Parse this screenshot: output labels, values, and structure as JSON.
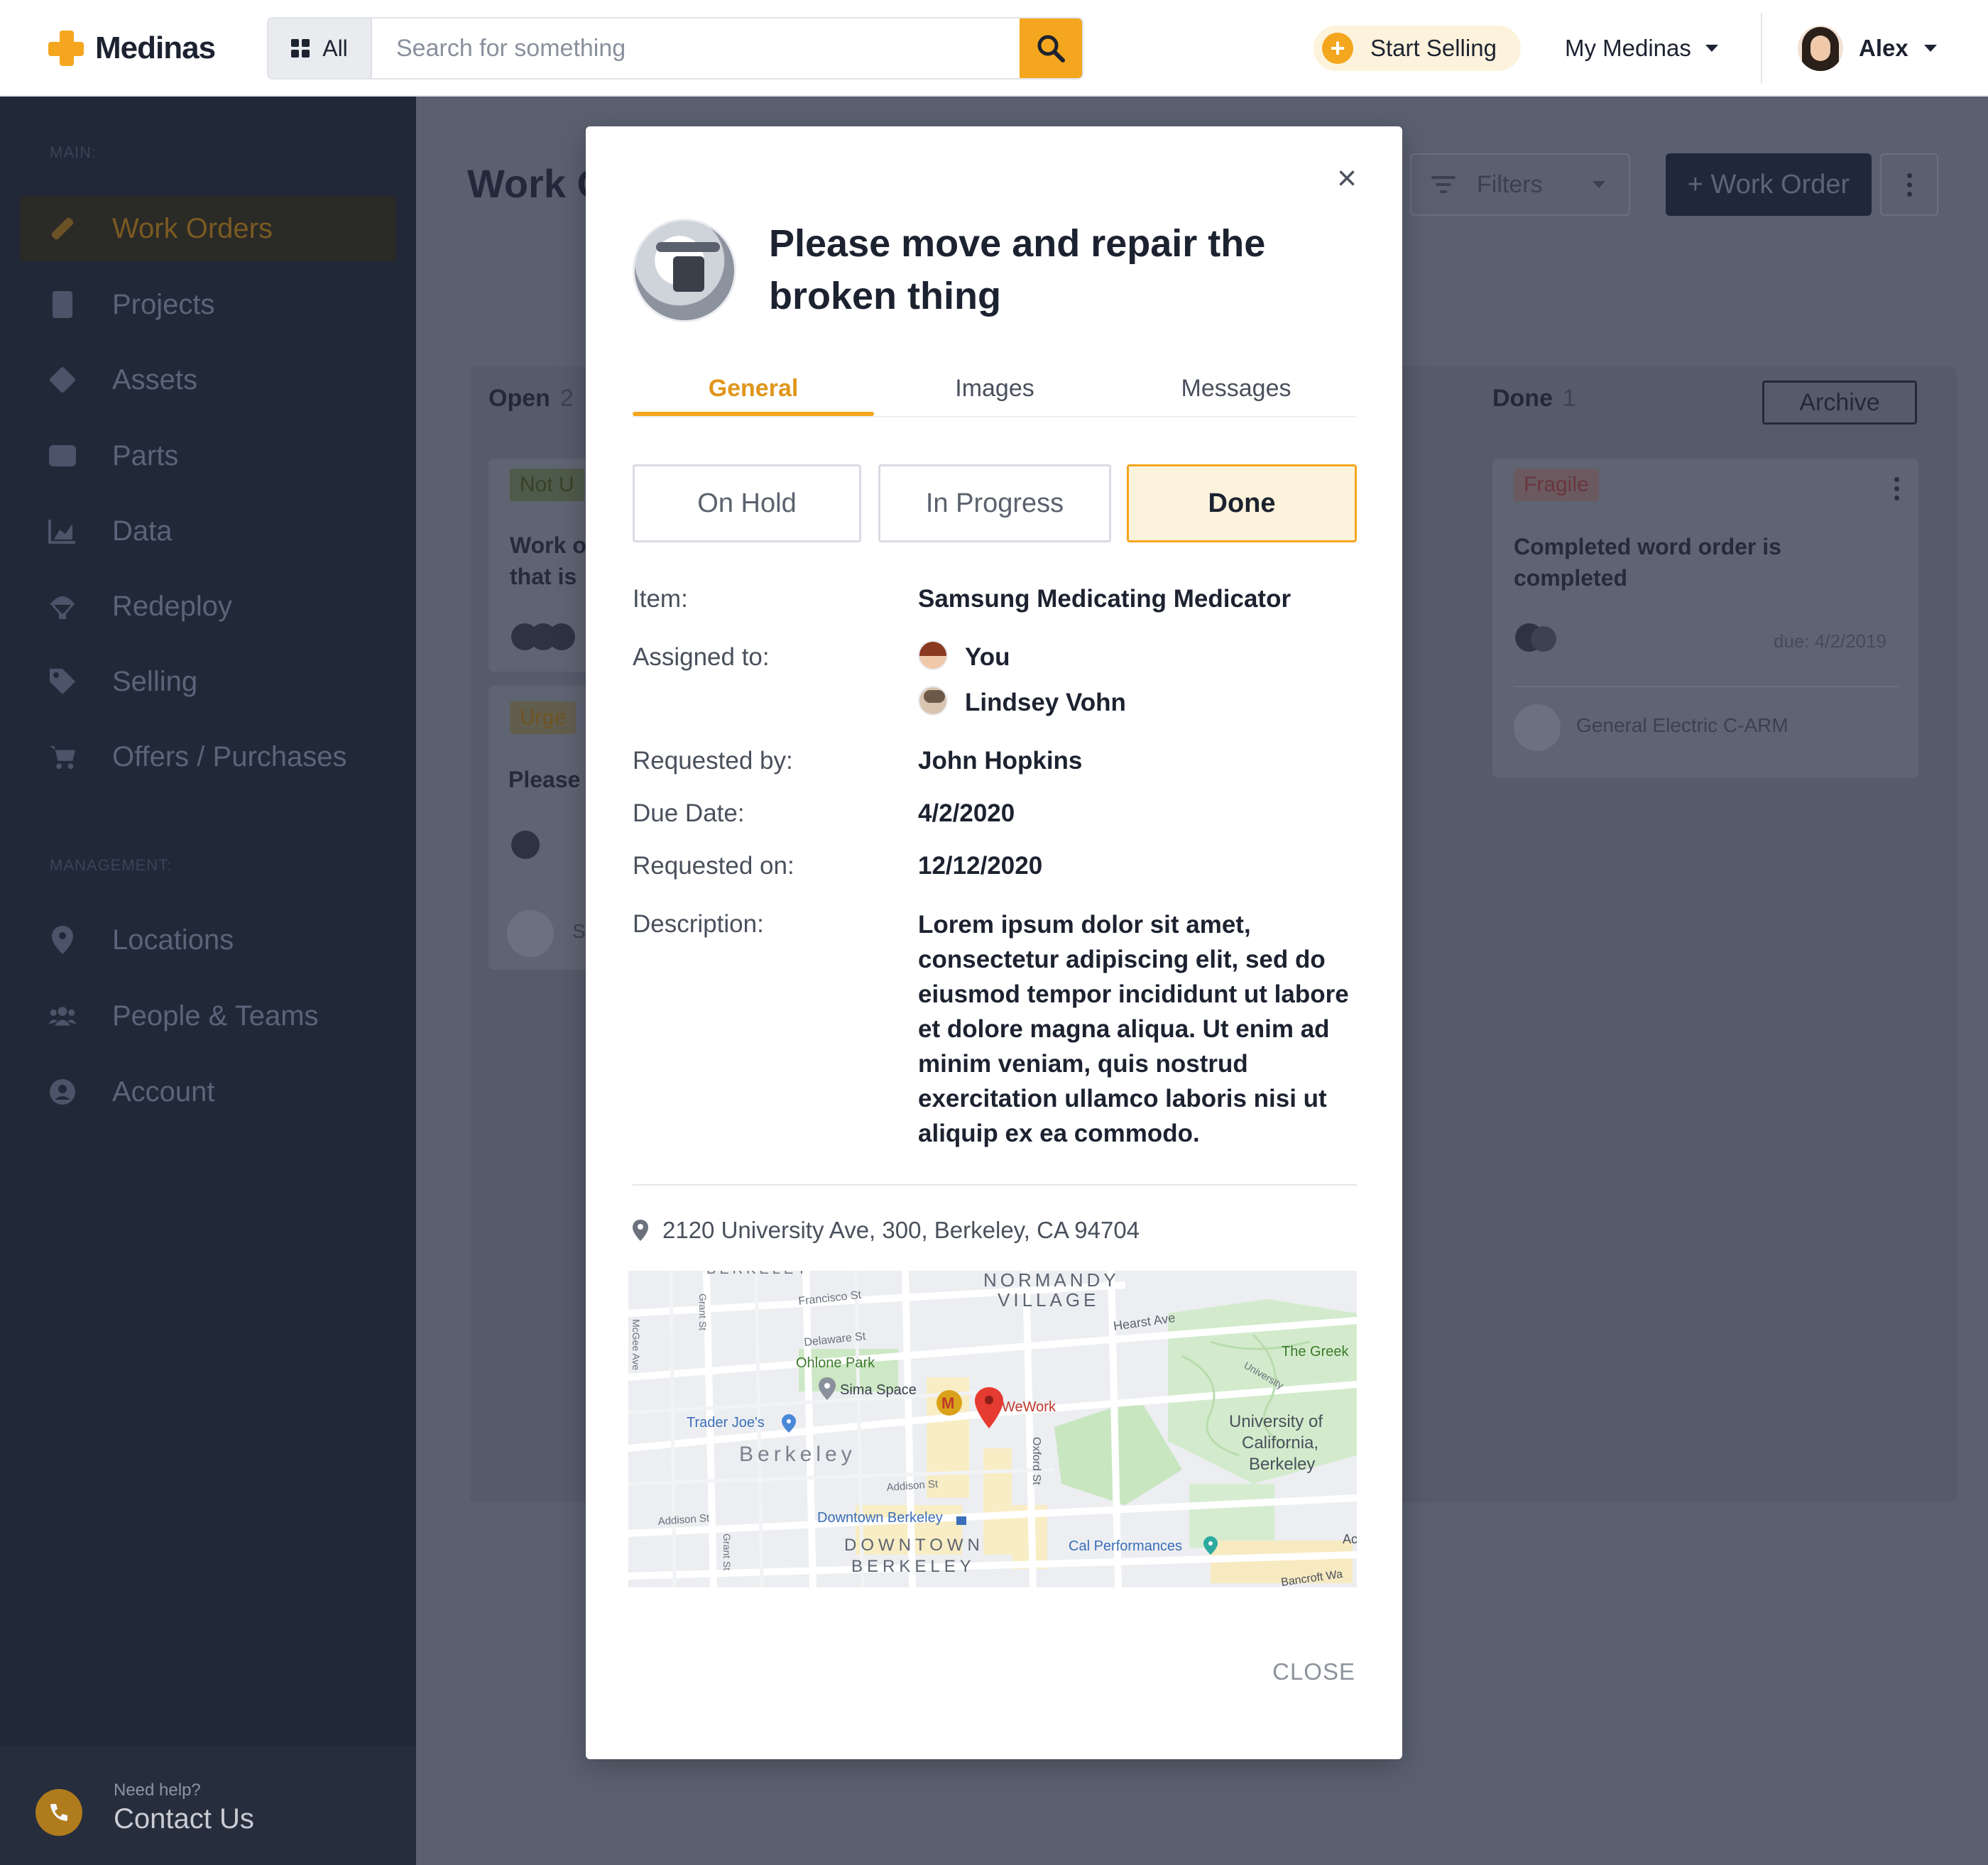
{
  "header": {
    "brand": "Medinas",
    "search_scope": "All",
    "search_placeholder": "Search for something",
    "start_selling": "Start Selling",
    "my_medinas": "My Medinas",
    "user_name": "Alex"
  },
  "sidebar": {
    "main_label": "MAIN:",
    "management_label": "MANAGEMENT:",
    "main_items": [
      {
        "label": "Work Orders",
        "icon": "wrench-icon"
      },
      {
        "label": "Projects",
        "icon": "clipboard-icon"
      },
      {
        "label": "Assets",
        "icon": "box-icon"
      },
      {
        "label": "Parts",
        "icon": "cubes-icon"
      },
      {
        "label": "Data",
        "icon": "chart-area-icon"
      },
      {
        "label": "Redeploy",
        "icon": "parachute-icon"
      },
      {
        "label": "Selling",
        "icon": "tag-icon"
      },
      {
        "label": "Offers / Purchases",
        "icon": "cart-icon"
      }
    ],
    "management_items": [
      {
        "label": "Locations",
        "icon": "map-marker-icon"
      },
      {
        "label": "People & Teams",
        "icon": "users-icon"
      },
      {
        "label": "Account",
        "icon": "user-circle-icon"
      }
    ],
    "help_small": "Need help?",
    "help_big": "Contact Us"
  },
  "background": {
    "page_title": "Work O",
    "filters": "Filters",
    "add_work_order": "+ Work Order",
    "open_col": {
      "title": "Open",
      "count": "2"
    },
    "done_col": {
      "title": "Done",
      "count": "1",
      "archive": "Archive"
    },
    "open_card1": {
      "tag": "Not U",
      "text1": "Work o",
      "text2": "that is"
    },
    "open_card2": {
      "tag": "Urge",
      "text": "Please",
      "asset": "S"
    },
    "done_card": {
      "tag": "Fragile",
      "text1": "Completed word order is",
      "text2": "completed",
      "due": "due: 4/2/2019",
      "asset": "General Electric C-ARM"
    }
  },
  "modal": {
    "title_line1": "Please move and repair the",
    "title_line2": "broken thing",
    "tabs": [
      "General",
      "Images",
      "Messages"
    ],
    "active_tab": "General",
    "statuses": [
      "On Hold",
      "In Progress",
      "Done"
    ],
    "active_status": "Done",
    "labels": {
      "item": "Item:",
      "assigned": "Assigned to:",
      "requested_by": "Requested by:",
      "due": "Due Date:",
      "requested_on": "Requested on:",
      "description": "Description:"
    },
    "item": "Samsung Medicating Medicator",
    "assignees": [
      "You",
      "Lindsey Vohn"
    ],
    "requested_by": "John Hopkins",
    "due_date": "4/2/2020",
    "requested_on": "12/12/2020",
    "description": "Lorem ipsum dolor sit amet, consectetur adipiscing elit, sed do eiusmod tempor incididunt ut labore et dolore magna aliqua. Ut enim ad minim veniam, quis nostrud exercitation ullamco laboris nisi ut aliquip ex ea commodo.",
    "address": "2120 University Ave, 300, Berkeley, CA 94704",
    "close": "CLOSE"
  },
  "map": {
    "labels": {
      "top": "BERKELEY",
      "normandy1": "NORMANDY",
      "normandy2": "VILLAGE",
      "francisco": "Francisco St",
      "delaware": "Delaware St",
      "hearst": "Hearst Ave",
      "ohlone": "Ohlone Park",
      "sima": "Sima Space",
      "trader": "Trader Joe's",
      "wework": "WeWork",
      "greek": "The Greek",
      "uc1": "University of",
      "uc2": "California,",
      "uc3": "Berkeley",
      "berkeley": "Berkeley",
      "addison1": "Addison St",
      "addison2": "Addison St",
      "oxford": "Oxford St",
      "grant1": "Grant St",
      "grant2": "Grant St",
      "mcgee": "McGee Ave",
      "univ": "University",
      "downtown_station": "Downtown Berkeley",
      "downtown1": "DOWNTOWN",
      "downtown2": "BERKELEY",
      "calperf": "Cal Performances",
      "bancroft": "Bancroft Wa",
      "ac": "Ac"
    },
    "colors": {
      "park": "#c8e6c0",
      "road": "#ffffff",
      "block": "#f8edc4",
      "marker": "#e53b30",
      "poi_blue": "#4a88d8"
    }
  },
  "colors": {
    "accent": "#f4a61e",
    "sidebar_bg": "#212838",
    "overlay_bg": "#5b6070"
  }
}
